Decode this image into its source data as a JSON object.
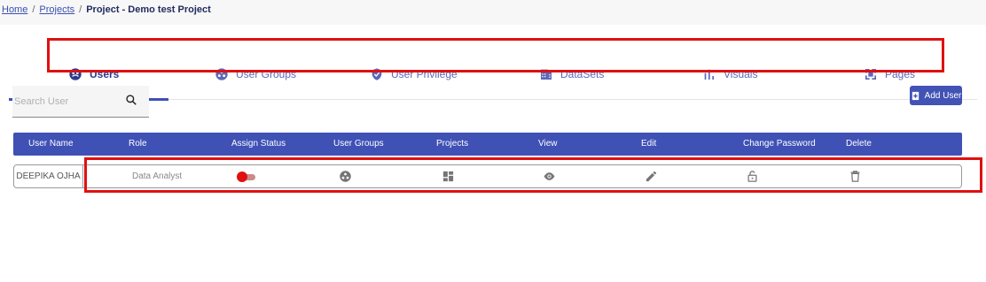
{
  "breadcrumb": {
    "home": "Home",
    "projects": "Projects",
    "sep": "/",
    "current": "Project - Demo test Project"
  },
  "tabs": [
    {
      "label": "Users",
      "icon": "users-icon",
      "active": true
    },
    {
      "label": "User Groups",
      "icon": "user-groups-icon",
      "active": false
    },
    {
      "label": "User Privilege",
      "icon": "shield-icon",
      "active": false
    },
    {
      "label": "DataSets",
      "icon": "dataset-icon",
      "active": false
    },
    {
      "label": "Visuals",
      "icon": "bar-chart-icon",
      "active": false
    },
    {
      "label": "Pages",
      "icon": "pages-icon",
      "active": false
    }
  ],
  "search": {
    "placeholder": "Search User",
    "value": ""
  },
  "add_user_label": "Add User",
  "table": {
    "columns": [
      "User Name",
      "Role",
      "Assign Status",
      "User Groups",
      "Projects",
      "View",
      "Edit",
      "Change Password",
      "Delete"
    ],
    "rows": [
      {
        "user_name": "DEEPIKA OJHA",
        "role": "Data Analyst",
        "assign_status": "off",
        "actions": [
          "user-groups-icon",
          "projects-icon",
          "view-icon",
          "edit-icon",
          "change-password-icon",
          "delete-icon"
        ]
      }
    ]
  },
  "colors": {
    "primary": "#3f51b5",
    "highlight": "#e01010",
    "toggle_knob": "#e01010"
  }
}
